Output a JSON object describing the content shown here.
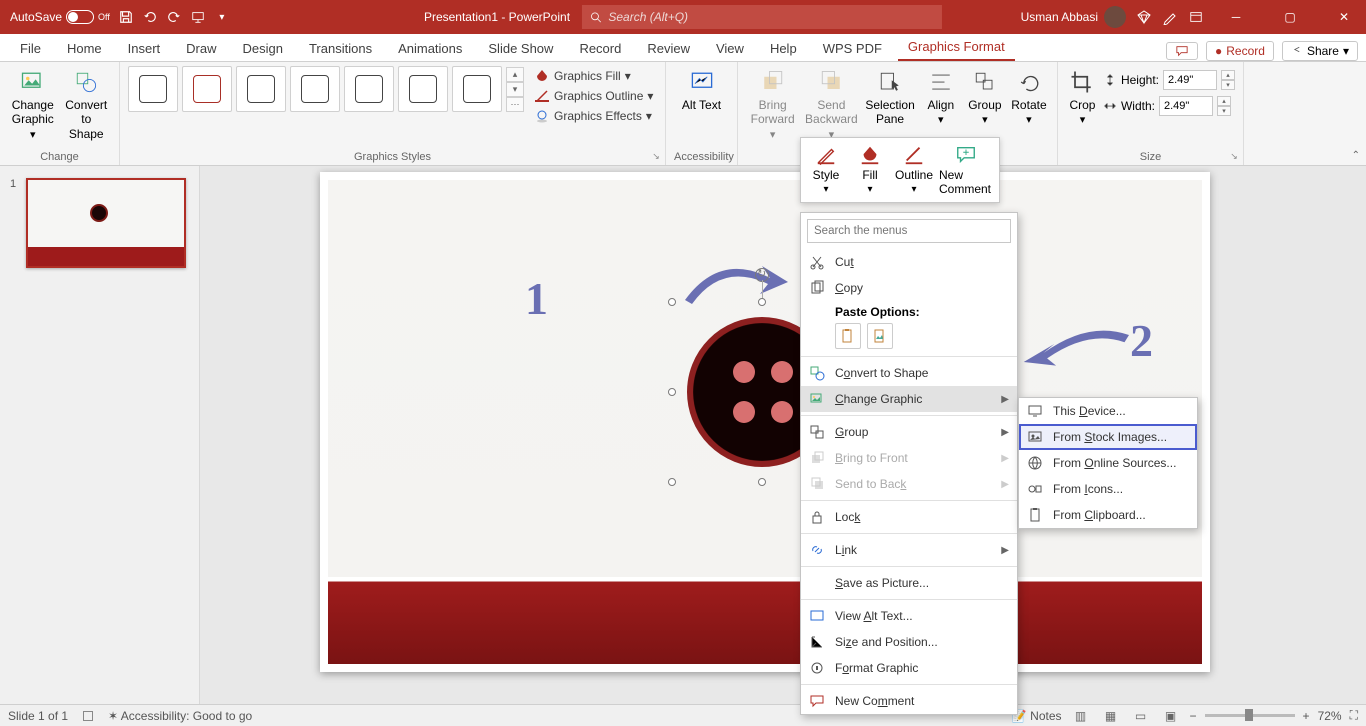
{
  "titlebar": {
    "autosave": "AutoSave",
    "autosave_state": "Off",
    "file_title": "Presentation1 - PowerPoint",
    "search_placeholder": "Search (Alt+Q)",
    "user": "Usman Abbasi"
  },
  "tabs": [
    "File",
    "Home",
    "Insert",
    "Draw",
    "Design",
    "Transitions",
    "Animations",
    "Slide Show",
    "Record",
    "Review",
    "View",
    "Help",
    "WPS PDF",
    "Graphics Format"
  ],
  "active_tab": "Graphics Format",
  "menubar_right": {
    "record": "Record",
    "share": "Share"
  },
  "ribbon": {
    "change": {
      "change_graphic": "Change Graphic",
      "convert_to_shape": "Convert to Shape",
      "label": "Change"
    },
    "styles": {
      "fill": "Graphics Fill",
      "outline": "Graphics Outline",
      "effects": "Graphics Effects",
      "label": "Graphics Styles"
    },
    "accessibility": {
      "alt_text": "Alt Text",
      "label": "Accessibility"
    },
    "arrange": {
      "bring_forward": "Bring Forward",
      "send_backward": "Send Backward",
      "selection_pane": "Selection Pane",
      "align": "Align",
      "group": "Group",
      "rotate": "Rotate"
    },
    "size": {
      "crop": "Crop",
      "height_label": "Height:",
      "height_value": "2.49\"",
      "width_label": "Width:",
      "width_value": "2.49\"",
      "label": "Size"
    }
  },
  "minitoolbar": {
    "style": "Style",
    "fill": "Fill",
    "outline": "Outline",
    "new_comment": "New Comment"
  },
  "thumb_num": "1",
  "annotations": {
    "one": "1",
    "two": "2"
  },
  "context_menu": {
    "search_placeholder": "Search the menus",
    "cut": "Cut",
    "copy": "Copy",
    "paste_heading": "Paste Options:",
    "convert_to_shape": "Convert to Shape",
    "change_graphic": "Change Graphic",
    "group": "Group",
    "bring_to_front": "Bring to Front",
    "send_to_back": "Send to Back",
    "lock": "Lock",
    "link": "Link",
    "save_as_picture": "Save as Picture...",
    "view_alt_text": "View Alt Text...",
    "size_and_position": "Size and Position...",
    "format_graphic": "Format Graphic",
    "new_comment": "New Comment"
  },
  "submenu": {
    "this_device": "This Device...",
    "from_stock": "From Stock Images...",
    "from_online": "From Online Sources...",
    "from_icons": "From Icons...",
    "from_clipboard": "From Clipboard..."
  },
  "statusbar": {
    "slide": "Slide 1 of 1",
    "accessibility": "Accessibility: Good to go",
    "notes": "Notes",
    "zoom": "72%"
  }
}
